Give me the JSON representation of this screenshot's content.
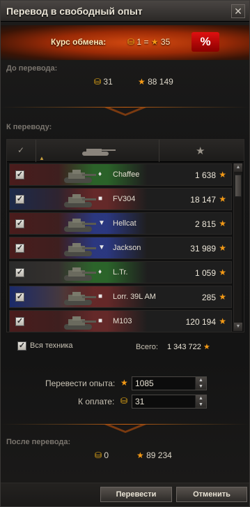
{
  "window": {
    "title": "Перевод в свободный опыт",
    "close_label": "✕"
  },
  "rate": {
    "label": "Курс обмена:",
    "gold": "1",
    "eq": "=",
    "exp": "35",
    "percent_label": "%"
  },
  "before": {
    "label": "До перевода:",
    "gold": "31",
    "exp": "88 149"
  },
  "transfer": {
    "label": "К переводу:"
  },
  "table": {
    "header_check": "✓",
    "header_star": "★",
    "rows": [
      {
        "tier": "♦",
        "name": "Chaffee",
        "exp": "1 638",
        "flag": "us",
        "type_color": "#2a6a2a",
        "selected": true
      },
      {
        "tier": "■",
        "name": "FV304",
        "exp": "18 147",
        "flag": "uk",
        "type_color": "#6a2a2a",
        "selected": true
      },
      {
        "tier": "▼",
        "name": "Hellcat",
        "exp": "2 815",
        "flag": "us",
        "type_color": "#2a3a8a",
        "selected": true
      },
      {
        "tier": "▼",
        "name": "Jackson",
        "exp": "31 989",
        "flag": "us",
        "type_color": "#2a3a8a",
        "selected": true
      },
      {
        "tier": "♦",
        "name": "L.Tr.",
        "exp": "1 059",
        "flag": "de",
        "type_color": "#2a6a2a",
        "selected": true
      },
      {
        "tier": "■",
        "name": "Lorr. 39L AM",
        "exp": "285",
        "flag": "fr",
        "type_color": "#6a2a2a",
        "selected": true
      },
      {
        "tier": "■",
        "name": "M103",
        "exp": "120 194",
        "flag": "us",
        "type_color": "#6a2a2a",
        "selected": true
      }
    ]
  },
  "all_vehicles": {
    "label": "Вся техника",
    "total_label": "Всего:",
    "total": "1 343 722"
  },
  "form": {
    "exp_label": "Перевести опыта:",
    "exp_value": "1085",
    "pay_label": "К оплате:",
    "pay_value": "31"
  },
  "after": {
    "label": "После перевода:",
    "gold": "0",
    "exp": "89 234"
  },
  "buttons": {
    "transfer": "Перевести",
    "cancel": "Отменить"
  },
  "colors": {
    "gold": "#f4b316",
    "star": "#f49a16",
    "accent": "#c86010"
  }
}
